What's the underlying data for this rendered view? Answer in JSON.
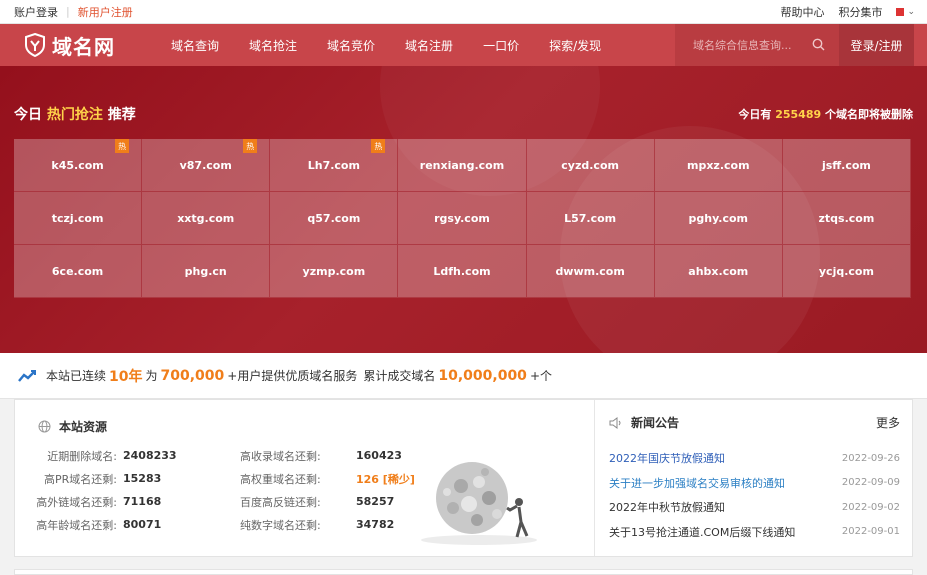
{
  "topbar": {
    "login": "账户登录",
    "register": "新用户注册",
    "help": "帮助中心",
    "market": "积分集市"
  },
  "nav": {
    "logo": "域名网",
    "menu": [
      "域名查询",
      "域名抢注",
      "域名竞价",
      "域名注册",
      "一口价",
      "探索/发现"
    ],
    "search_placeholder": "域名综合信息查询...",
    "login": "登录/注册",
    "accent": "#c8454a"
  },
  "hero": {
    "title_prefix": "今日",
    "title_highlight": "热门抢注",
    "title_suffix": "推荐",
    "count_prefix": "今日有",
    "count_value": "255489",
    "count_suffix": "个域名即将被删除",
    "hot_label": "热",
    "domains": [
      {
        "name": "k45.com",
        "hot": true
      },
      {
        "name": "v87.com",
        "hot": true
      },
      {
        "name": "Lh7.com",
        "hot": true
      },
      {
        "name": "renxiang.com",
        "hot": false
      },
      {
        "name": "cyzd.com",
        "hot": false
      },
      {
        "name": "mpxz.com",
        "hot": false
      },
      {
        "name": "jsff.com",
        "hot": false
      },
      {
        "name": "tczj.com",
        "hot": false
      },
      {
        "name": "xxtg.com",
        "hot": false
      },
      {
        "name": "q57.com",
        "hot": false
      },
      {
        "name": "rgsy.com",
        "hot": false
      },
      {
        "name": "L57.com",
        "hot": false
      },
      {
        "name": "pghy.com",
        "hot": false
      },
      {
        "name": "ztqs.com",
        "hot": false
      },
      {
        "name": "6ce.com",
        "hot": false
      },
      {
        "name": "phg.cn",
        "hot": false
      },
      {
        "name": "yzmp.com",
        "hot": false
      },
      {
        "name": "Ldfh.com",
        "hot": false
      },
      {
        "name": "dwwm.com",
        "hot": false
      },
      {
        "name": "ahbx.com",
        "hot": false
      },
      {
        "name": "ycjq.com",
        "hot": false
      }
    ]
  },
  "strip": {
    "t1": "本站已连续",
    "years": "10年",
    "t2": "为",
    "users": "700,000",
    "t3": "+用户提供优质域名服务",
    "t4": "累计成交域名",
    "total": "10,000,000",
    "t5": "+个"
  },
  "resources": {
    "title": "本站资源",
    "left": [
      {
        "label": "近期删除域名:",
        "value": "2408233"
      },
      {
        "label": "高PR域名还剩:",
        "value": "15283"
      },
      {
        "label": "高外链域名还剩:",
        "value": "71168"
      },
      {
        "label": "高年龄域名还剩:",
        "value": "80071"
      }
    ],
    "right": [
      {
        "label": "高收录域名还剩:",
        "value": "160423"
      },
      {
        "label": "高权重域名还剩:",
        "value": "126 [稀少]"
      },
      {
        "label": "百度高反链还剩:",
        "value": "58257"
      },
      {
        "label": "纯数字域名还剩:",
        "value": "34782"
      }
    ]
  },
  "news": {
    "title": "新闻公告",
    "more": "更多",
    "items": [
      {
        "title": "2022年国庆节放假通知",
        "date": "2022-09-26"
      },
      {
        "title": "关于进一步加强域名交易审核的通知",
        "date": "2022-09-09"
      },
      {
        "title": "2022年中秋节放假通知",
        "date": "2022-09-02"
      },
      {
        "title": "关于13号抢注通道.COM后缀下线通知",
        "date": "2022-09-01"
      }
    ]
  }
}
